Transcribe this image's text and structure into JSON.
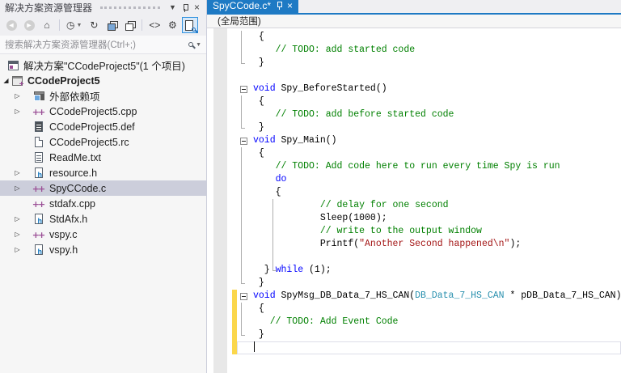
{
  "colors": {
    "accent": "#1E7AC4",
    "keyword": "#0000FF",
    "comment": "#008000",
    "string": "#A31515",
    "type": "#2B91AF",
    "modified_bar": "#FBD74B",
    "inactive_selection": "#CCCEDB"
  },
  "solution_explorer": {
    "title": "解决方案资源管理器",
    "caption_icons": [
      {
        "name": "window-position-dropdown-icon",
        "glyph": "▼"
      },
      {
        "name": "pin-icon",
        "glyph": ""
      },
      {
        "name": "close-icon",
        "glyph": "×"
      }
    ],
    "toolbar": [
      {
        "type": "btn",
        "name": "back-button",
        "icon": "circle",
        "glyph": "◄",
        "disabled": true
      },
      {
        "type": "btn",
        "name": "forward-button",
        "icon": "circle",
        "glyph": "►",
        "disabled": true
      },
      {
        "type": "btn",
        "name": "home-button",
        "glyph": "⌂"
      },
      {
        "type": "sep"
      },
      {
        "type": "btn",
        "name": "switch-views-button",
        "glyph": "◷",
        "dropdown": true
      },
      {
        "type": "btn",
        "name": "refresh-button",
        "glyph": "↻"
      },
      {
        "type": "btn",
        "name": "collapse-all-button",
        "icon": "stack"
      },
      {
        "type": "btn",
        "name": "show-all-files-button",
        "icon": "stack-light"
      },
      {
        "type": "sep"
      },
      {
        "type": "btn",
        "name": "view-code-button",
        "glyph": "<>"
      },
      {
        "type": "btn",
        "name": "properties-wrench-button",
        "glyph": "⚙"
      },
      {
        "type": "btn",
        "name": "sync-with-active-document-button",
        "icon": "doc-mag",
        "active": true
      }
    ],
    "search_placeholder": "搜索解决方案资源管理器(Ctrl+;)",
    "tree": [
      {
        "lvl": 0,
        "arrow": null,
        "icon": "solution",
        "label": "解决方案\"CCodeProject5\"(1 个项目)"
      },
      {
        "lvl": 1,
        "arrow": "exp",
        "icon": "project",
        "label": "CCodeProject5",
        "bold": true
      },
      {
        "lvl": 2,
        "arrow": "col",
        "icon": "deps",
        "label": "外部依赖项"
      },
      {
        "lvl": 2,
        "arrow": "col",
        "icon": "cpp",
        "label": "CCodeProject5.cpp"
      },
      {
        "lvl": 2,
        "arrow": null,
        "icon": "def",
        "label": "CCodeProject5.def"
      },
      {
        "lvl": 2,
        "arrow": null,
        "icon": "rc",
        "label": "CCodeProject5.rc"
      },
      {
        "lvl": 2,
        "arrow": null,
        "icon": "txt",
        "label": "ReadMe.txt"
      },
      {
        "lvl": 2,
        "arrow": "col",
        "icon": "h",
        "label": "resource.h"
      },
      {
        "lvl": 2,
        "arrow": "col",
        "icon": "cpp",
        "label": "SpyCCode.c",
        "selected": true
      },
      {
        "lvl": 2,
        "arrow": null,
        "icon": "cpp",
        "label": "stdafx.cpp"
      },
      {
        "lvl": 2,
        "arrow": "col",
        "icon": "h",
        "label": "StdAfx.h"
      },
      {
        "lvl": 2,
        "arrow": "col",
        "icon": "cpp",
        "label": "vspy.c"
      },
      {
        "lvl": 2,
        "arrow": "col",
        "icon": "h",
        "label": "vspy.h"
      }
    ]
  },
  "editor": {
    "tab_title": "SpyCCode.c*",
    "scope": "(全局范围)",
    "lines": [
      {
        "segs": [
          [
            "p",
            " {"
          ]
        ]
      },
      {
        "segs": [
          [
            "c",
            "    // TODO: add started code"
          ]
        ]
      },
      {
        "segs": [
          [
            "p",
            " }"
          ]
        ]
      },
      {
        "segs": []
      },
      {
        "segs": [
          [
            "k",
            "void"
          ],
          [
            "p",
            " Spy_BeforeStarted()"
          ]
        ],
        "outline": true
      },
      {
        "segs": [
          [
            "p",
            " {"
          ]
        ]
      },
      {
        "segs": [
          [
            "c",
            "    // TODO: add before started code"
          ]
        ]
      },
      {
        "segs": [
          [
            "p",
            " }"
          ]
        ]
      },
      {
        "segs": [
          [
            "k",
            "void"
          ],
          [
            "p",
            " Spy_Main()"
          ]
        ],
        "outline": true
      },
      {
        "segs": [
          [
            "p",
            " {"
          ]
        ]
      },
      {
        "segs": [
          [
            "c",
            "    // TODO: Add code here to run every time Spy is run"
          ]
        ]
      },
      {
        "segs": [
          [
            "p",
            "    "
          ],
          [
            "k",
            "do"
          ]
        ]
      },
      {
        "segs": [
          [
            "p",
            "    {"
          ]
        ]
      },
      {
        "segs": [
          [
            "c",
            "            // delay for one second"
          ]
        ]
      },
      {
        "segs": [
          [
            "p",
            "            Sleep(1000);"
          ]
        ]
      },
      {
        "segs": [
          [
            "c",
            "            // write to the output window"
          ]
        ]
      },
      {
        "segs": [
          [
            "p",
            "            Printf("
          ],
          [
            "s",
            "\"Another Second happened\\n\""
          ],
          [
            "p",
            ");"
          ]
        ]
      },
      {
        "segs": []
      },
      {
        "segs": [
          [
            "p",
            "  } "
          ],
          [
            "k",
            "while"
          ],
          [
            "p",
            " (1);"
          ]
        ]
      },
      {
        "segs": [
          [
            "p",
            " }"
          ]
        ]
      },
      {
        "segs": [
          [
            "k",
            "void"
          ],
          [
            "p",
            " SpyMsg_DB_Data_7_HS_CAN("
          ],
          [
            "t",
            "DB_Data_7_HS_CAN"
          ],
          [
            "p",
            " * pDB_Data_7_HS_CAN)"
          ]
        ],
        "outline": true,
        "modified": true
      },
      {
        "segs": [
          [
            "p",
            " {"
          ]
        ],
        "modified": true
      },
      {
        "segs": [
          [
            "c",
            "   // TODO: Add Event Code"
          ]
        ],
        "modified": true
      },
      {
        "segs": [
          [
            "p",
            " }"
          ]
        ],
        "modified": true
      },
      {
        "segs": [],
        "modified": true,
        "caret": true
      }
    ],
    "guides": [
      {
        "from": 1,
        "to": 3,
        "col": "outer"
      },
      {
        "from": 6,
        "to": 8,
        "col": "outer"
      },
      {
        "from": 10,
        "to": 20,
        "col": "outer"
      },
      {
        "from": 14,
        "to": 19,
        "col": "inner"
      },
      {
        "from": 22,
        "to": 24,
        "col": "outer"
      }
    ]
  }
}
